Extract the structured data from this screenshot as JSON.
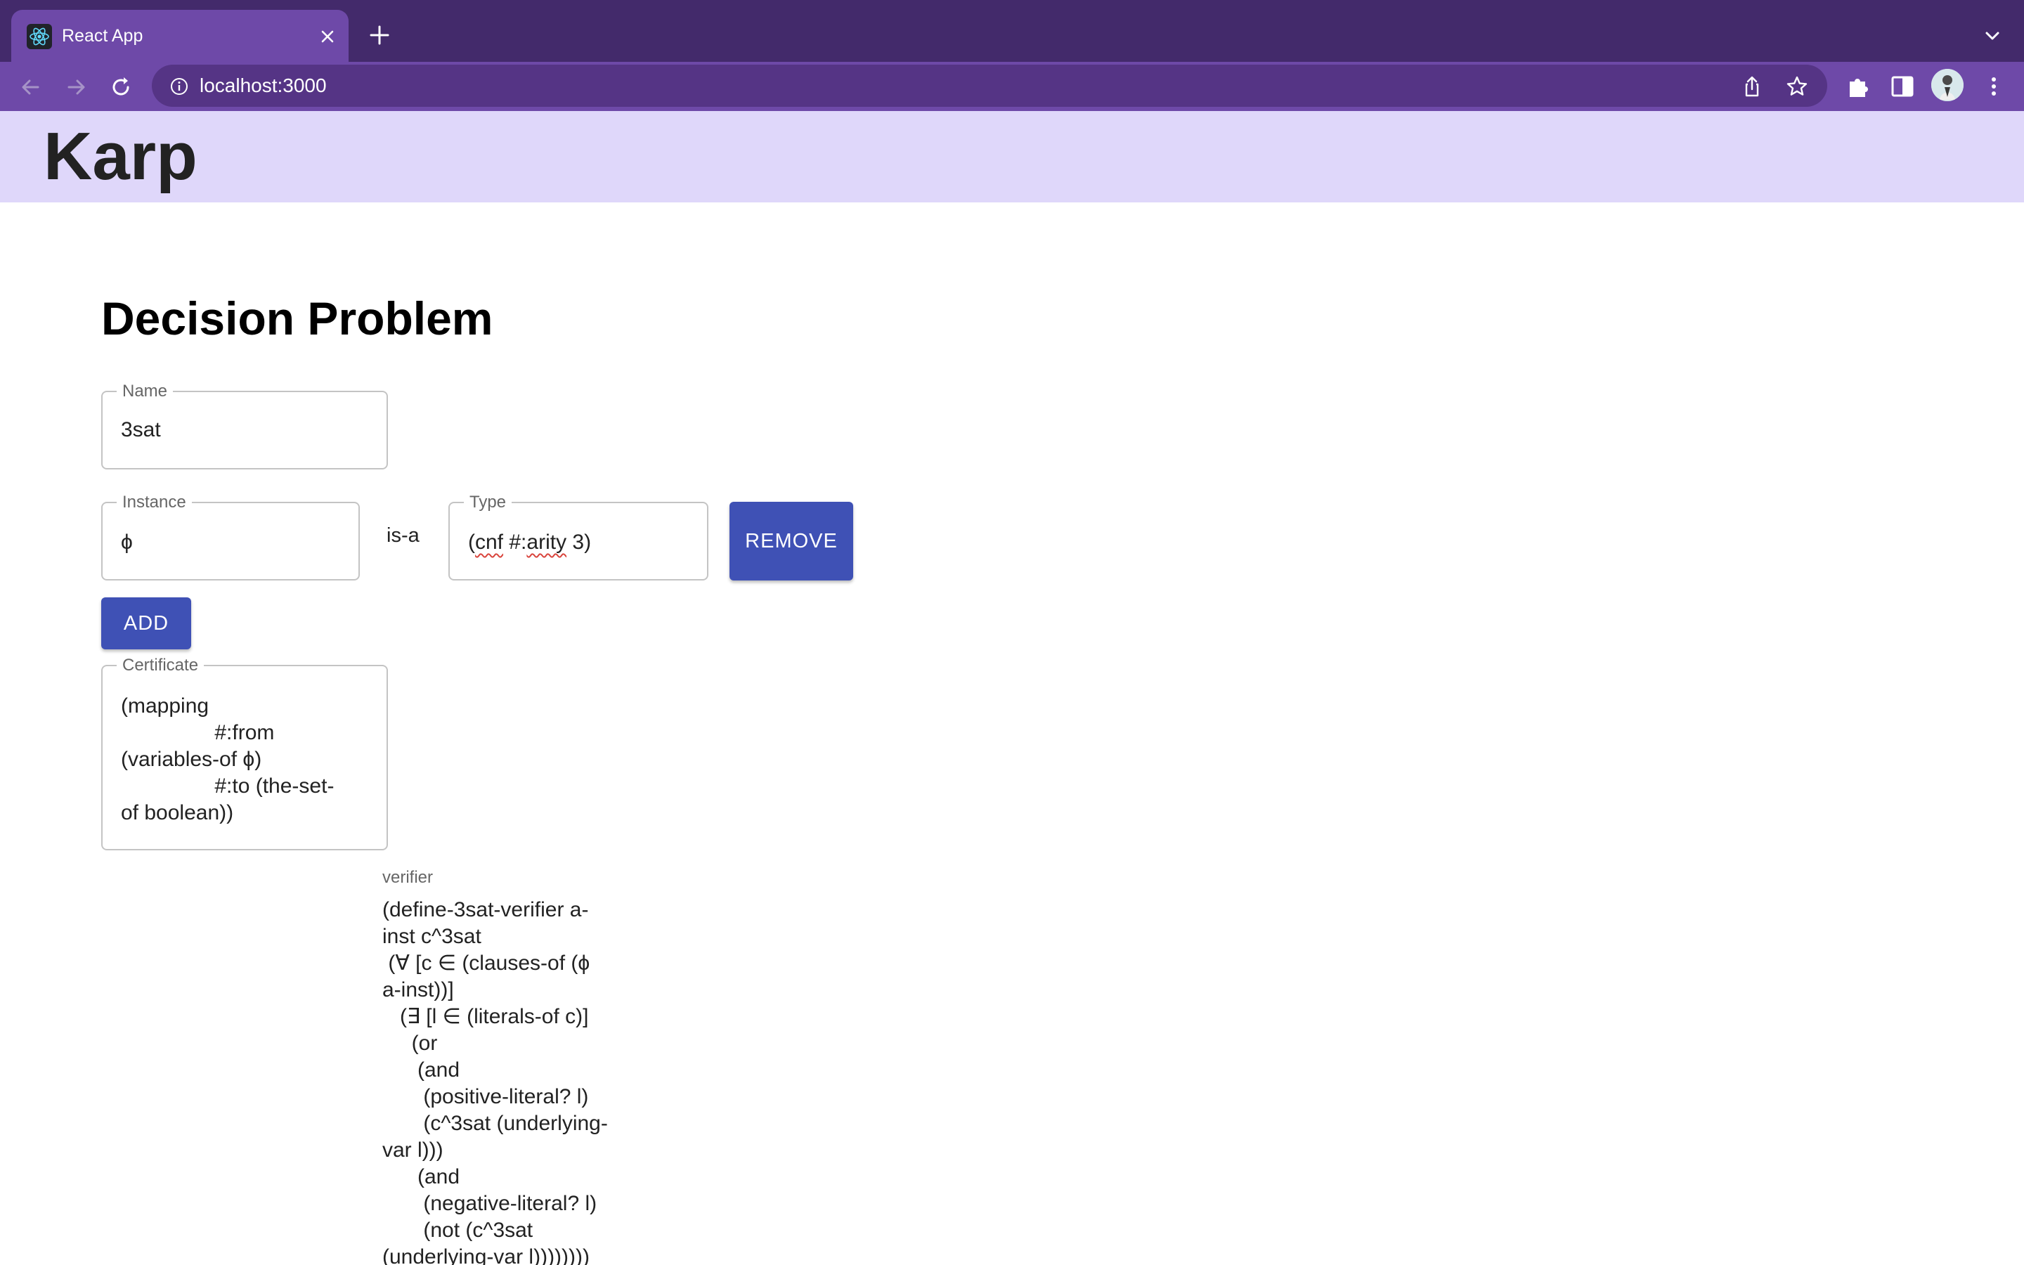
{
  "browser": {
    "tab_title": "React App",
    "url": "localhost:3000"
  },
  "app": {
    "title": "Karp"
  },
  "decision_problem": {
    "heading": "Decision Problem",
    "name_label": "Name",
    "name_value": "3sat",
    "instance_label": "Instance",
    "instance_value": "ϕ",
    "is_a": "is-a",
    "type_label": "Type",
    "type_value_open": "(",
    "type_value_word1": "cnf",
    "type_value_mid": " #:",
    "type_value_word2": "arity",
    "type_value_close": " 3)",
    "remove_label": "REMOVE",
    "add_label": "ADD",
    "certificate_label": "Certificate",
    "certificate_value": "(mapping\n                #:from\n(variables-of ϕ)\n                #:to (the-set-\nof boolean))",
    "verifier_label": "verifier",
    "verifier_code": "(define-3sat-verifier a-\ninst c^3sat\n (∀ [c ∈ (clauses-of (ϕ\na-inst))]\n   (∃ [l ∈ (literals-of c)]\n     (or\n      (and\n       (positive-literal? l)\n       (c^3sat (underlying-\nvar l)))\n      (and\n       (negative-literal? l)\n       (not (c^3sat\n(underlying-var l))))))))"
  }
}
